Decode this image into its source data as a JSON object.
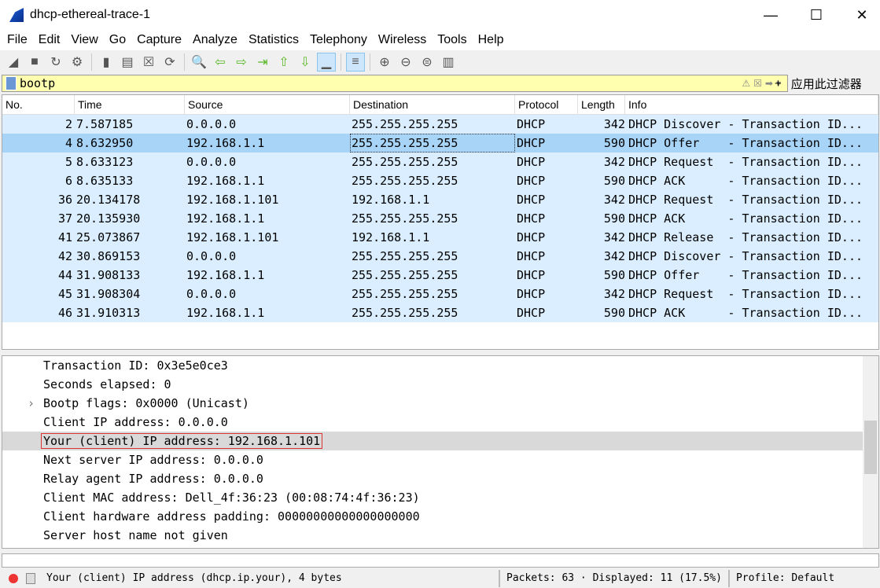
{
  "window": {
    "title": "dhcp-ethereal-trace-1",
    "minimize": "—",
    "maximize": "☐",
    "close": "✕"
  },
  "menu": [
    "File",
    "Edit",
    "View",
    "Go",
    "Capture",
    "Analyze",
    "Statistics",
    "Telephony",
    "Wireless",
    "Tools",
    "Help"
  ],
  "toolbar": [
    "shark-start-icon",
    "stop-icon",
    "restart-icon",
    "options-icon",
    "|",
    "open-icon",
    "save-icon",
    "close-file-icon",
    "reload-icon",
    "|",
    "find-icon",
    "back-icon",
    "forward-icon",
    "goto-icon",
    "first-icon",
    "last-icon",
    "autoscroll-icon",
    "|",
    "colorize-icon",
    "|",
    "zoom-in-icon",
    "zoom-out-icon",
    "zoom-reset-icon",
    "resize-columns-icon"
  ],
  "filter": {
    "value": "bootp",
    "apply_label": "应用此过滤器",
    "plus": "+"
  },
  "columns": [
    "No.",
    "Time",
    "Source",
    "Destination",
    "Protocol",
    "Length",
    "Info"
  ],
  "packets": [
    [
      "2",
      "7.587185",
      "0.0.0.0",
      "255.255.255.255",
      "DHCP",
      "342",
      "DHCP Discover - Transaction ID..."
    ],
    [
      "4",
      "8.632950",
      "192.168.1.1",
      "255.255.255.255",
      "DHCP",
      "590",
      "DHCP Offer    - Transaction ID..."
    ],
    [
      "5",
      "8.633123",
      "0.0.0.0",
      "255.255.255.255",
      "DHCP",
      "342",
      "DHCP Request  - Transaction ID..."
    ],
    [
      "6",
      "8.635133",
      "192.168.1.1",
      "255.255.255.255",
      "DHCP",
      "590",
      "DHCP ACK      - Transaction ID..."
    ],
    [
      "36",
      "20.134178",
      "192.168.1.101",
      "192.168.1.1",
      "DHCP",
      "342",
      "DHCP Request  - Transaction ID..."
    ],
    [
      "37",
      "20.135930",
      "192.168.1.1",
      "255.255.255.255",
      "DHCP",
      "590",
      "DHCP ACK      - Transaction ID..."
    ],
    [
      "41",
      "25.073867",
      "192.168.1.101",
      "192.168.1.1",
      "DHCP",
      "342",
      "DHCP Release  - Transaction ID..."
    ],
    [
      "42",
      "30.869153",
      "0.0.0.0",
      "255.255.255.255",
      "DHCP",
      "342",
      "DHCP Discover - Transaction ID..."
    ],
    [
      "44",
      "31.908133",
      "192.168.1.1",
      "255.255.255.255",
      "DHCP",
      "590",
      "DHCP Offer    - Transaction ID..."
    ],
    [
      "45",
      "31.908304",
      "0.0.0.0",
      "255.255.255.255",
      "DHCP",
      "342",
      "DHCP Request  - Transaction ID..."
    ],
    [
      "46",
      "31.910313",
      "192.168.1.1",
      "255.255.255.255",
      "DHCP",
      "590",
      "DHCP ACK      - Transaction ID..."
    ]
  ],
  "selected_packet_index": 1,
  "details": [
    {
      "text": "Transaction ID: 0x3e5e0ce3"
    },
    {
      "text": "Seconds elapsed: 0"
    },
    {
      "text": "Bootp flags: 0x0000 (Unicast)",
      "expandable": true
    },
    {
      "text": "Client IP address: 0.0.0.0"
    },
    {
      "text": "Your (client) IP address: 192.168.1.101",
      "selected": true
    },
    {
      "text": "Next server IP address: 0.0.0.0"
    },
    {
      "text": "Relay agent IP address: 0.0.0.0"
    },
    {
      "text": "Client MAC address: Dell_4f:36:23 (00:08:74:4f:36:23)"
    },
    {
      "text": "Client hardware address padding: 00000000000000000000"
    },
    {
      "text": "Server host name not given"
    }
  ],
  "status": {
    "field": "Your (client) IP address (dhcp.ip.your), 4 bytes",
    "packets": "Packets: 63 · Displayed: 11 (17.5%)",
    "profile": "Profile: Default"
  }
}
